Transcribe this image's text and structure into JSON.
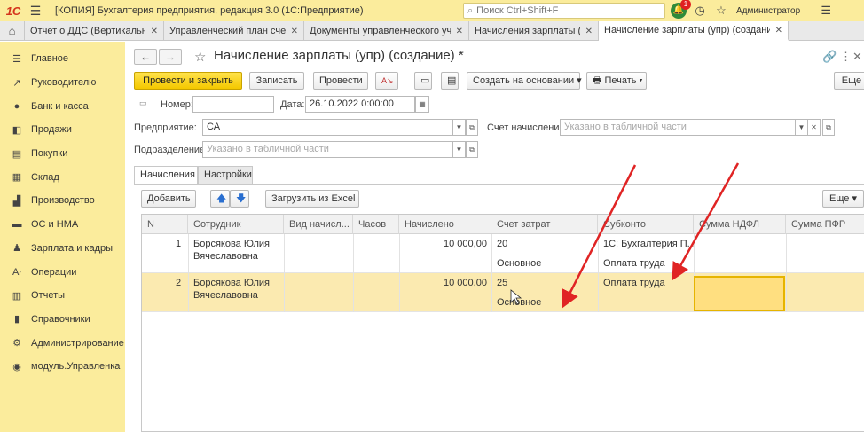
{
  "titlebar": {
    "logo": "1С",
    "app_title": "[КОПИЯ] Бухгалтерия предприятия, редакция 3.0  (1С:Предприятие)",
    "search_placeholder": "Поиск Ctrl+Shift+F",
    "notification_count": "1",
    "user": "Администратор"
  },
  "tabs": [
    {
      "label": "Отчет о ДДС (Вертикальный)"
    },
    {
      "label": "Управленческий план счетов"
    },
    {
      "label": "Документы управленческого учета"
    },
    {
      "label": "Начисления зарплаты (упр)"
    },
    {
      "label": "Начисление зарплаты (упр) (создание) *"
    }
  ],
  "sidebar": {
    "items": [
      {
        "label": "Главное",
        "icon": "menu-lines-icon"
      },
      {
        "label": "Руководителю",
        "icon": "trend-chart-icon"
      },
      {
        "label": "Банк и касса",
        "icon": "coin-icon"
      },
      {
        "label": "Продажи",
        "icon": "sales-icon"
      },
      {
        "label": "Покупки",
        "icon": "cart-icon"
      },
      {
        "label": "Склад",
        "icon": "warehouse-icon"
      },
      {
        "label": "Производство",
        "icon": "factory-icon"
      },
      {
        "label": "ОС и НМА",
        "icon": "assets-icon"
      },
      {
        "label": "Зарплата и кадры",
        "icon": "people-icon"
      },
      {
        "label": "Операции",
        "icon": "operations-icon"
      },
      {
        "label": "Отчеты",
        "icon": "reports-icon"
      },
      {
        "label": "Справочники",
        "icon": "books-icon"
      },
      {
        "label": "Администрирование",
        "icon": "gear-icon"
      },
      {
        "label": "модуль.Управленка",
        "icon": "module-icon"
      }
    ]
  },
  "form": {
    "title": "Начисление зарплаты (упр) (создание) *",
    "toolbar": {
      "post_close": "Провести и закрыть",
      "save": "Записать",
      "post": "Провести",
      "create_based": "Создать на основании",
      "print": "Печать",
      "more": "Еще"
    },
    "number_label": "Номер:",
    "number_value": "",
    "date_label": "Дата:",
    "date_value": "26.10.2022  0:00:00",
    "enterprise_label": "Предприятие:",
    "enterprise_value": "СА",
    "account_label": "Счет начисления:",
    "account_placeholder": "Указано в табличной части",
    "division_label": "Подразделение:",
    "division_placeholder": "Указано в табличной части",
    "tabs": {
      "accruals": "Начисления",
      "settings": "Настройки"
    },
    "table_toolbar": {
      "add": "Добавить",
      "load_excel": "Загрузить из Excel",
      "more": "Еще"
    },
    "columns": [
      "N",
      "Сотрудник",
      "Вид начисл...",
      "Часов",
      "Начислено",
      "Счет затрат",
      "Субконто",
      "Сумма НДФЛ",
      "Сумма ПФР"
    ],
    "rows": [
      {
        "n": "1",
        "employee_1": "Борсякова Юлия",
        "employee_2": "Вячеславовна",
        "accrued": "10 000,00",
        "cost_account": "20",
        "cost_sub": "Основное",
        "subconto_1": "1С: Бухгалтерия П...",
        "subconto_2": "Оплата труда"
      },
      {
        "n": "2",
        "employee_1": "Борсякова Юлия",
        "employee_2": "Вячеславовна",
        "accrued": "10 000,00",
        "cost_account": "25",
        "cost_sub": "Основное",
        "subconto_1": "Оплата труда",
        "subconto_2": ""
      }
    ]
  },
  "colors": {
    "accent_yellow": "#fbec9c",
    "primary_button": "#f4c800",
    "arrow_red": "#e02424"
  }
}
